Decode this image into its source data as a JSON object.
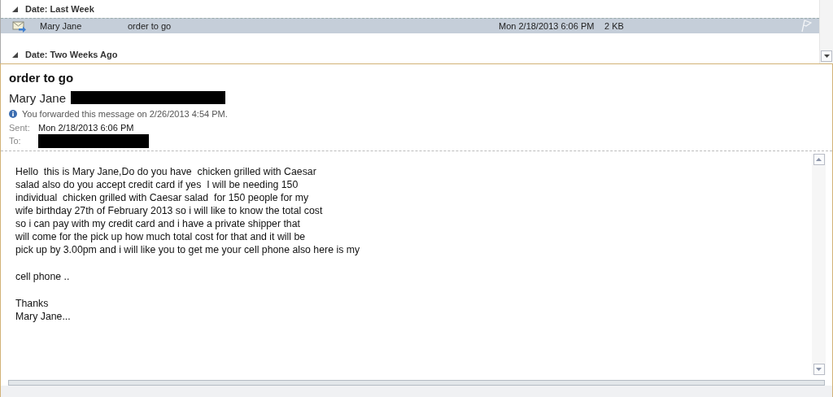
{
  "message_list": {
    "groups": [
      {
        "label": "Date: Last Week",
        "expanded": true,
        "messages": [
          {
            "sender": "Mary Jane",
            "subject": "order to go",
            "received": "Mon 2/18/2013 6:06 PM",
            "size": "2 KB",
            "selected": true
          }
        ]
      },
      {
        "label": "Date: Two Weeks Ago",
        "expanded": true
      }
    ]
  },
  "reading_pane": {
    "subject": "order to go",
    "sender": "Mary Jane",
    "info": "You forwarded this message on 2/26/2013 4:54 PM.",
    "fields": [
      {
        "label": "Sent:",
        "value": "Mon 2/18/2013 6:06 PM"
      },
      {
        "label": "To:",
        "redacted": true
      }
    ],
    "body": [
      "Hello  this is Mary Jane,Do do you have  chicken grilled with Caesar\nsalad also do you accept credit card if yes  I will be needing 150\nindividual  chicken grilled with Caesar salad  for 150 people for my\nwife birthday 27th of February 2013 so i will like to know the total cost\nso i can pay with my credit card and i have a private shipper that\nwill come for the pick up how much total cost for that and it will be\npick up by 3.00pm and i will like you to get me your cell phone also here is my",
      "cell phone ..",
      "Thanks\nMary Jane..."
    ]
  }
}
